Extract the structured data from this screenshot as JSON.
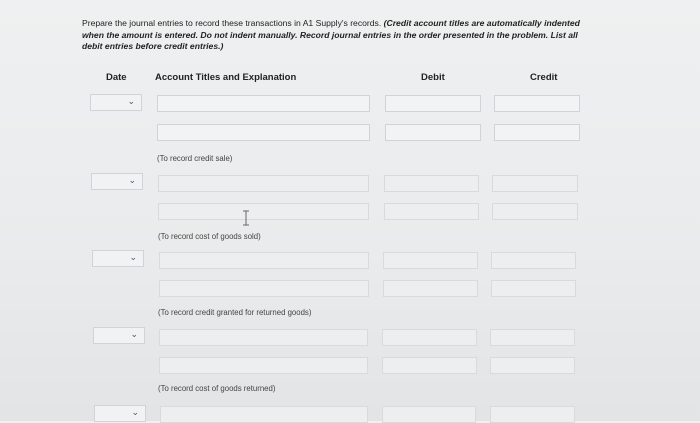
{
  "instructions": {
    "plain": "Prepare the journal entries to record these transactions in A1 Supply's records.",
    "emphasis": "(Credit account titles are automatically indented when the amount is entered. Do not indent manually. Record journal entries in the order presented in the problem. List all debit entries before credit entries.)"
  },
  "table": {
    "headers": {
      "date": "Date",
      "account": "Account Titles and Explanation",
      "debit": "Debit",
      "credit": "Credit"
    },
    "entries": [
      {
        "date_value": "",
        "lines": 2,
        "note": "(To record credit sale)"
      },
      {
        "date_value": "",
        "lines": 2,
        "note": "(To record cost of goods sold)"
      },
      {
        "date_value": "",
        "lines": 2,
        "note": "(To record credit granted for returned goods)"
      },
      {
        "date_value": "",
        "lines": 2,
        "note": "(To record cost of goods returned)"
      }
    ]
  },
  "icons": {
    "dropdown": "chevron-down-icon",
    "cursor": "text-cursor-icon"
  }
}
